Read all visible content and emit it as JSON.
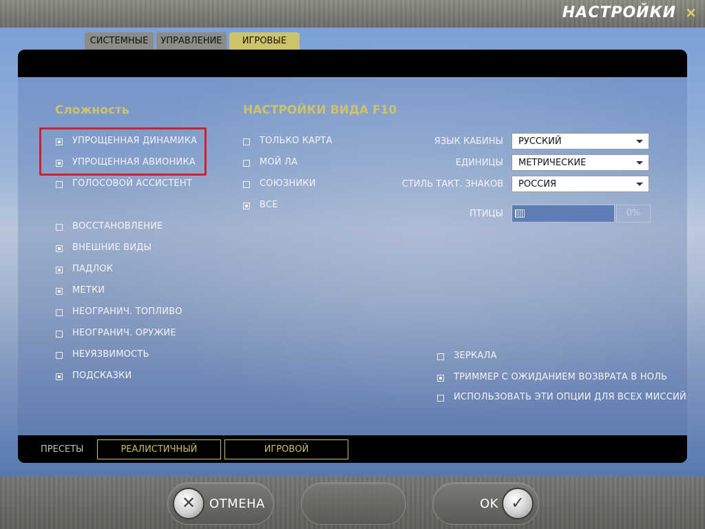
{
  "window": {
    "title": "НАСТРОЙКИ",
    "close_icon": "×"
  },
  "tabs": [
    {
      "label": "СИСТЕМНЫЕ",
      "active": false
    },
    {
      "label": "УПРАВЛЕНИЕ",
      "active": false
    },
    {
      "label": "ИГРОВЫЕ",
      "active": true
    }
  ],
  "difficulty": {
    "heading": "Сложность",
    "options": [
      {
        "label": "УПРОЩЕННАЯ ДИНАМИКА",
        "checked": true
      },
      {
        "label": "УПРОЩЕННАЯ АВИОНИКА",
        "checked": true
      },
      {
        "label": "ГОЛОСОВОЙ АССИСТЕНТ",
        "checked": false
      },
      {
        "label": "ВОССТАНОВЛЕНИЕ",
        "checked": false
      },
      {
        "label": "ВНЕШНИЕ ВИДЫ",
        "checked": true
      },
      {
        "label": "ПАДЛОК",
        "checked": true
      },
      {
        "label": "МЕТКИ",
        "checked": true
      },
      {
        "label": "НЕОГРАНИЧ. ТОПЛИВО",
        "checked": false
      },
      {
        "label": "НЕОГРАНИЧ. ОРУЖИЕ",
        "checked": false
      },
      {
        "label": "НЕУЯЗВИМОСТЬ",
        "checked": false
      },
      {
        "label": "ПОДСКАЗКИ",
        "checked": true
      }
    ]
  },
  "f10": {
    "heading": "НАСТРОЙКИ ВИДА F10",
    "options": [
      {
        "label": "ТОЛЬКО КАРТА",
        "checked": false
      },
      {
        "label": "МОЙ ЛА",
        "checked": false
      },
      {
        "label": "СОЮЗНИКИ",
        "checked": false
      },
      {
        "label": "ВСЕ",
        "checked": true
      }
    ]
  },
  "settings": {
    "cockpit_language": {
      "label": "ЯЗЫК КАБИНЫ",
      "value": "РУССКИЙ"
    },
    "units": {
      "label": "ЕДИНИЦЫ",
      "value": "МЕТРИЧЕСКИЕ"
    },
    "tactical_symbols": {
      "label": "СТИЛЬ ТАКТ. ЗНАКОВ",
      "value": "РОССИЯ"
    },
    "birds": {
      "label": "ПТИЦЫ",
      "value": "0%",
      "level": 0
    }
  },
  "extra_options": [
    {
      "label": "ЗЕРКАЛА",
      "checked": false
    },
    {
      "label": "ТРИММЕР С ОЖИДАНИЕМ ВОЗВРАТА В НОЛЬ",
      "checked": true
    },
    {
      "label": "ИСПОЛЬЗОВАТЬ ЭТИ ОПЦИИ ДЛЯ ВСЕХ МИССИЙ",
      "checked": false
    }
  ],
  "presets": {
    "label": "ПРЕСЕТЫ",
    "realistic": "РЕАЛИСТИЧНЫЙ",
    "game": "ИГРОВОЙ"
  },
  "footer": {
    "cancel": "ОТМЕНА",
    "ok": "OK",
    "cancel_icon": "✕",
    "ok_icon": "✓"
  },
  "colors": {
    "accent": "#cdc46a",
    "highlight": "#d2202a"
  }
}
